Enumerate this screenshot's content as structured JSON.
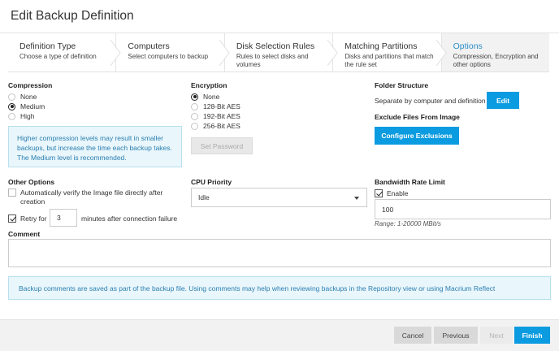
{
  "dialog": {
    "title": "Edit Backup Definition"
  },
  "steps": [
    {
      "title": "Definition Type",
      "desc": "Choose a type of definition"
    },
    {
      "title": "Computers",
      "desc": "Select computers to backup"
    },
    {
      "title": "Disk Selection Rules",
      "desc": "Rules to select disks and volumes"
    },
    {
      "title": "Matching Partitions",
      "desc": "Disks and partitions that match the rule set"
    },
    {
      "title": "Options",
      "desc": "Compression, Encryption and other options"
    }
  ],
  "compression": {
    "label": "Compression",
    "options": [
      "None",
      "Medium",
      "High"
    ],
    "selected": "Medium",
    "info": "Higher compression levels may result in smaller backups, but increase the time each backup takes. The Medium level is recommended."
  },
  "encryption": {
    "label": "Encryption",
    "options": [
      "None",
      "128-Bit AES",
      "192-Bit AES",
      "256-Bit AES"
    ],
    "selected": "None",
    "set_password": "Set Password"
  },
  "folder_structure": {
    "label": "Folder Structure",
    "value": "Separate by computer and definition",
    "edit": "Edit"
  },
  "exclude": {
    "label": "Exclude Files From Image",
    "button": "Configure Exclusions"
  },
  "other_options": {
    "label": "Other Options",
    "verify": "Automatically verify the Image file directly after creation",
    "verify_checked": false,
    "retry_prefix": "Retry for",
    "retry_value": "3",
    "retry_suffix": "minutes after connection failure",
    "retry_checked": true
  },
  "cpu_priority": {
    "label": "CPU Priority",
    "value": "Idle"
  },
  "bandwidth": {
    "label": "Bandwidth Rate Limit",
    "enable": "Enable",
    "enable_checked": true,
    "value": "100",
    "range": "Range: 1-20000 MBit/s"
  },
  "comment": {
    "label": "Comment",
    "value": "",
    "info": "Backup comments are saved as part of the backup file. Using comments may help when reviewing backups in the Repository view or using Macrium Reflect"
  },
  "footer": {
    "cancel": "Cancel",
    "previous": "Previous",
    "next": "Next",
    "finish": "Finish"
  },
  "colors": {
    "accent": "#0a9be0",
    "info_bg": "#e9f6fb",
    "info_text": "#2b7fb0"
  }
}
